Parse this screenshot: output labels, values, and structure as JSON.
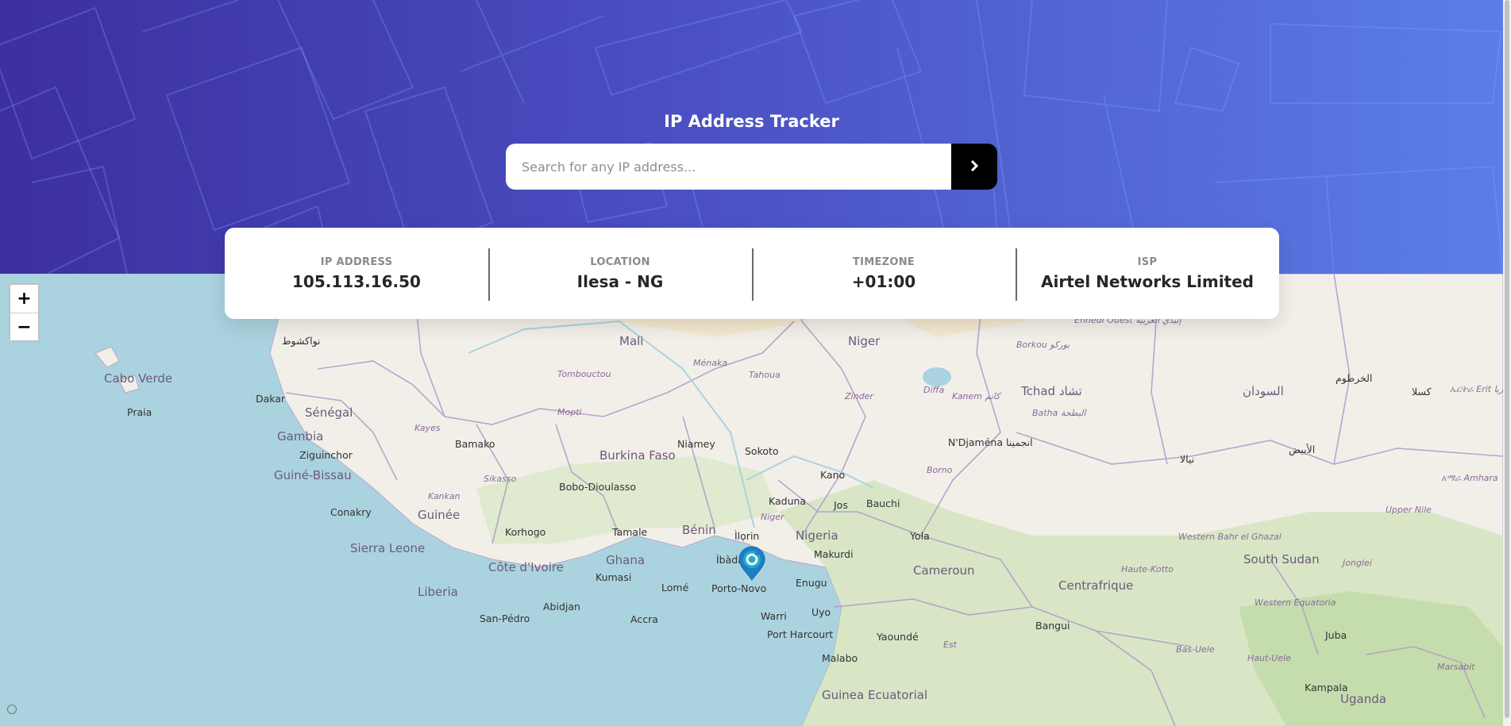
{
  "header": {
    "title": "IP Address Tracker",
    "search": {
      "placeholder": "Search for any IP address...",
      "value": "",
      "submit_icon": "chevron-right-icon"
    }
  },
  "info": {
    "ip": {
      "label": "IP ADDRESS",
      "value": "105.113.16.50"
    },
    "location": {
      "label": "LOCATION",
      "value": "Ilesa - NG"
    },
    "timezone": {
      "label": "TIMEZONE",
      "value": "+01:00"
    },
    "isp": {
      "label": "ISP",
      "value": "Airtel Networks Limited"
    }
  },
  "map": {
    "zoom_in": "+",
    "zoom_out": "−",
    "marker_icon": "location-pin-icon",
    "labels": {
      "mali": "Mali",
      "niger": "Niger",
      "tchad": "Tchad تشاد",
      "senegal": "Sénégal",
      "gambia": "Gambia",
      "guinebissau": "Guiné-Bissau",
      "guinee": "Guinée",
      "sierraleone": "Sierra Leone",
      "liberia": "Liberia",
      "cotedivoire": "Côte d'Ivoire",
      "ghana": "Ghana",
      "burkina": "Burkina Faso",
      "benin": "Bénin",
      "nigeria": "Nigeria",
      "cameroun": "Cameroun",
      "centrafrique": "Centrafrique",
      "southsudan": "South Sudan",
      "sudan": "السودان",
      "uganda": "Uganda",
      "guineaeq": "Guinea Ecuatorial",
      "caboverde": "Cabo Verde",
      "praia": "Praia",
      "dakar": "Dakar",
      "nouakchott": "نواكشوط",
      "bamako": "Bamako",
      "conakry": "Conakry",
      "niamey": "Niamey",
      "sokoto": "Sokoto",
      "kano": "Kano",
      "kaduna": "Kaduna",
      "jos": "Jos",
      "bauchi": "Bauchi",
      "ndjamena": "N'Djaména انجمينا",
      "bobo": "Bobo-Dioulasso",
      "korhogo": "Korhogo",
      "tamale": "Tamale",
      "kumasi": "Kumasi",
      "abidjan": "Abidjan",
      "accra": "Accra",
      "lome": "Lomé",
      "portonovo": "Porto-Novo",
      "ibadan": "Ìbàdàn",
      "ilorin": "Ìlọrin",
      "makurdi": "Makurdi",
      "enugu": "Enugu",
      "uyo": "Uyo",
      "warri": "Warri",
      "portharcourt": "Port Harcourt",
      "yaounde": "Yaoundé",
      "malabo": "Malabo",
      "yola": "Yola",
      "bangui": "Bangui",
      "juba": "Juba",
      "kampala": "Kampala",
      "sanpedro": "San-Pédro",
      "ziguinchor": "Ziguinchor",
      "khartoum": "الخرطوم",
      "nyala": "نيالا",
      "ubayyid": "الأبيض",
      "kassala": "كسلا",
      "tombouctou": "Tombouctou",
      "menaka": "Ménaka",
      "tahoua": "Tahoua",
      "zinder": "Zinder",
      "diffa": "Diffa",
      "mopti": "Mopti",
      "kayes": "Kayes",
      "sikasso": "Sikasso",
      "kankan": "Kankan",
      "borkou": "Borkou بوركو",
      "kanem": "Kanem كانم",
      "batha": "Batha البطحة",
      "borno": "Borno",
      "nigerriver": "Niger",
      "hautekotto": "Haute-Kotto",
      "basuele": "Bas-Uele",
      "hautuele": "Haut-Uele",
      "westernbahr": "Western Bahr el Ghazal",
      "westernequatoria": "Western Equatoria",
      "jonglei": "Jonglei",
      "uppernile": "Upper Nile",
      "est": "Est",
      "ennedi": "Ennedi Ouest إنيدي الغربية",
      "eritrea": "ኤርትራ Erit ارتريا",
      "amhara": "አማራ Amhara",
      "marsabit": "Marsabit"
    }
  }
}
